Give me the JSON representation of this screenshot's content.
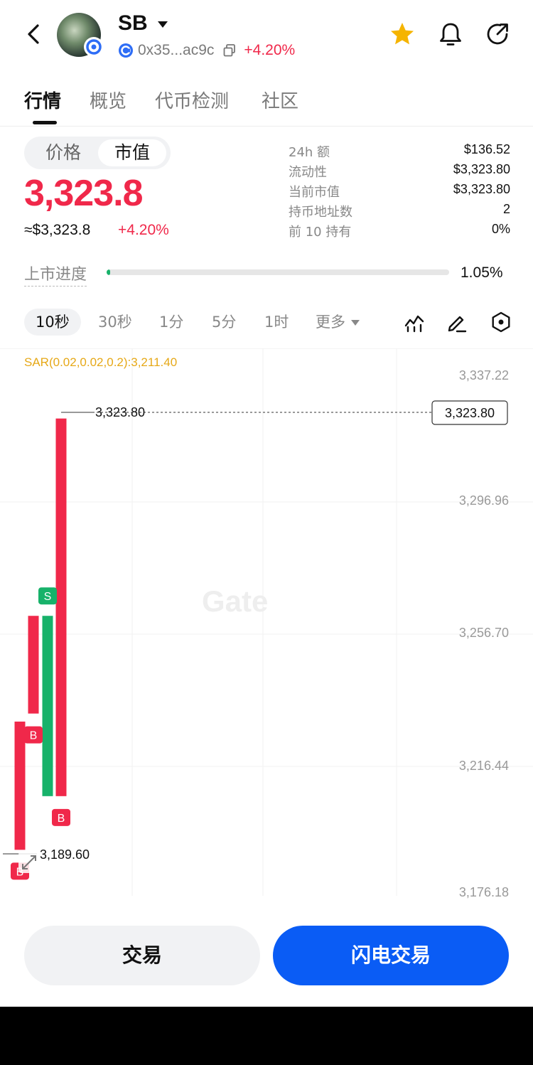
{
  "header": {
    "token_name": "SB",
    "address": "0x35...ac9c",
    "change": "+4.20%",
    "icons": [
      "back-arrow-icon",
      "token-avatar",
      "chain-badge-icon",
      "dropdown-caret-icon",
      "copy-icon",
      "star-icon",
      "bell-icon",
      "share-icon"
    ],
    "star_color": "#F5B400"
  },
  "tabs": [
    {
      "label": "行情",
      "active": true
    },
    {
      "label": "概览",
      "active": false
    },
    {
      "label": "代币检测",
      "active": false
    },
    {
      "label": "社区",
      "active": false
    }
  ],
  "price_toggle": {
    "price_label": "价格",
    "mcap_label": "市值",
    "selected": "市值"
  },
  "main_value": "3,323.8",
  "usd_value": "≈$3,323.8",
  "usd_change": "+4.20%",
  "stats": [
    {
      "label": "24h  额",
      "value": "$136.52"
    },
    {
      "label": "流动性",
      "value": "$3,323.80"
    },
    {
      "label": "当前市值",
      "value": "$3,323.80"
    },
    {
      "label": "持币地址数",
      "value": "2"
    },
    {
      "label": "前 10 持有",
      "value": "0%"
    }
  ],
  "listing_progress": {
    "label": "上市进度",
    "value": "1.05%",
    "fraction": 0.0105
  },
  "intervals": [
    {
      "label": "10秒",
      "active": true
    },
    {
      "label": "30秒",
      "active": false
    },
    {
      "label": "1分",
      "active": false
    },
    {
      "label": "5分",
      "active": false
    },
    {
      "label": "1时",
      "active": false
    },
    {
      "label": "更多",
      "active": false
    }
  ],
  "chart_tools": [
    "indicator-icon",
    "draw-pen-icon",
    "settings-hexagon-icon"
  ],
  "chart": {
    "indicator_label": "SAR(0.02,0.02,0.2):3,211.40",
    "watermark": "Gate",
    "y_ticks": [
      "3,337.22",
      "3,296.96",
      "3,256.70",
      "3,216.44",
      "3,176.18"
    ],
    "current_price_tag": "3,323.80",
    "high_label": "3,323.80",
    "low_label": "3,189.60",
    "colors": {
      "up": "#F0284A",
      "down": "#17B26A",
      "sar": "#E6A817"
    }
  },
  "chart_data": {
    "type": "candlestick",
    "ylim": [
      3176.18,
      3337.22
    ],
    "candles": [
      {
        "open": 3189.6,
        "close": 3229.5,
        "color": "red"
      },
      {
        "open": 3232.0,
        "close": 3262.4,
        "color": "red"
      },
      {
        "open": 3262.4,
        "close": 3206.3,
        "color": "green"
      },
      {
        "open": 3206.3,
        "close": 3323.8,
        "color": "red"
      }
    ],
    "markers": [
      {
        "label": "B",
        "candle": 0
      },
      {
        "label": "B",
        "candle": 1
      },
      {
        "label": "S",
        "candle": 2
      },
      {
        "label": "B",
        "candle": 3
      }
    ]
  },
  "actions": {
    "trade_label": "交易",
    "flash_trade_label": "闪电交易"
  }
}
